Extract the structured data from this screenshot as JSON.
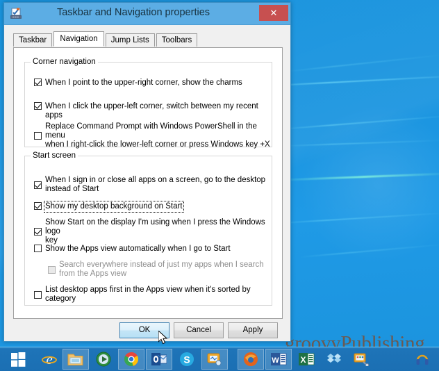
{
  "window": {
    "title": "Taskbar and Navigation properties",
    "icon": "taskbar-properties-icon",
    "close_label": "✕",
    "titlebar_color": "#5cade4",
    "close_color": "#c75050"
  },
  "tabs": [
    {
      "label": "Taskbar",
      "active": false
    },
    {
      "label": "Navigation",
      "active": true
    },
    {
      "label": "Jump Lists",
      "active": false
    },
    {
      "label": "Toolbars",
      "active": false
    }
  ],
  "groups": [
    {
      "legend": "Corner navigation",
      "options": [
        {
          "label": "When I point to the upper-right corner, show the charms",
          "checked": true,
          "enabled": true,
          "focused": false
        },
        {
          "label": "When I click the upper-left corner, switch between my recent apps",
          "checked": true,
          "enabled": true,
          "focused": false
        },
        {
          "label": "Replace Command Prompt with Windows PowerShell in the menu\nwhen I right-click the lower-left corner or press Windows key +X",
          "checked": false,
          "enabled": true,
          "focused": false
        }
      ]
    },
    {
      "legend": "Start screen",
      "options": [
        {
          "label": "When I sign in or close all apps on a screen, go to the desktop\ninstead of Start",
          "checked": true,
          "enabled": true,
          "focused": false
        },
        {
          "label": "Show my desktop background on Start",
          "checked": true,
          "enabled": true,
          "focused": true
        },
        {
          "label": "Show Start on the display I'm using when I press the Windows logo\nkey",
          "checked": true,
          "enabled": true,
          "focused": false
        },
        {
          "label": "Show the Apps view automatically when I go to Start",
          "checked": false,
          "enabled": true,
          "focused": false
        },
        {
          "label": "Search everywhere instead of just my apps when I search\nfrom the Apps view",
          "checked": false,
          "enabled": false,
          "focused": false
        },
        {
          "label": "List desktop apps first in the Apps view when it's sorted by\ncategory",
          "checked": false,
          "enabled": true,
          "focused": false
        }
      ]
    }
  ],
  "buttons": {
    "ok": "OK",
    "cancel": "Cancel",
    "apply": "Apply",
    "hovered": "ok"
  },
  "desktop": {
    "watermark": "groovyPublishing",
    "background_color": "#1b95e0"
  },
  "taskbar": {
    "background_color": "#1e74b8",
    "start_button": "start-button",
    "items": [
      {
        "name": "internet-explorer-icon",
        "running": false
      },
      {
        "name": "file-explorer-icon",
        "running": true
      },
      {
        "name": "windows-media-player-icon",
        "running": false
      },
      {
        "name": "google-chrome-icon",
        "running": true
      },
      {
        "name": "outlook-icon",
        "running": true
      },
      {
        "name": "skype-icon",
        "running": false
      },
      {
        "name": "snipping-tool-icon",
        "running": true
      },
      {
        "name": "firefox-icon",
        "running": true
      },
      {
        "name": "word-icon",
        "running": true
      },
      {
        "name": "excel-icon",
        "running": false
      },
      {
        "name": "dropbox-icon",
        "running": false
      },
      {
        "name": "paint-icon",
        "running": false
      }
    ],
    "tray": {
      "name": "headphones-tray-icon"
    }
  }
}
